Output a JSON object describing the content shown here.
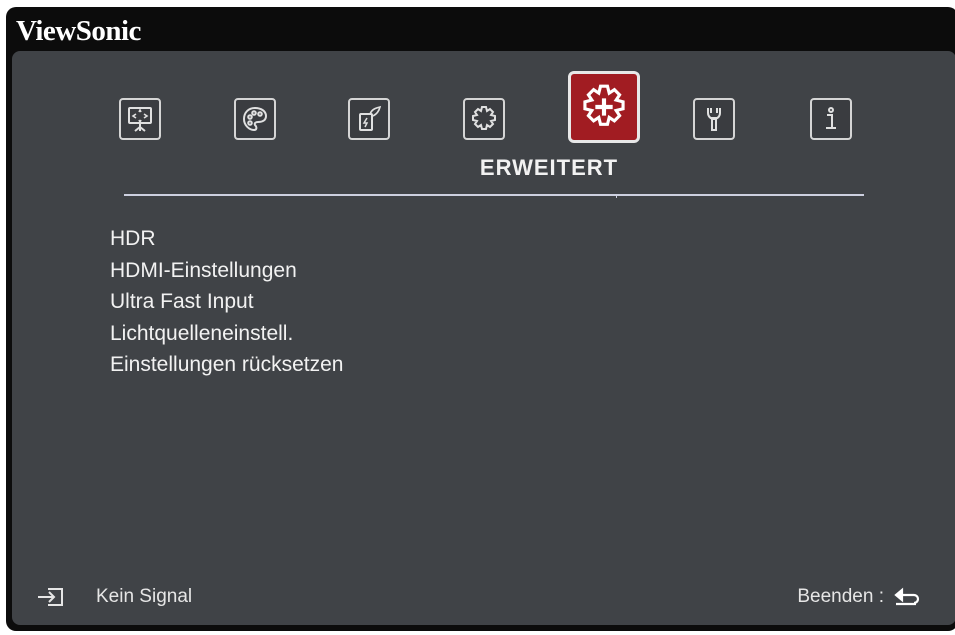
{
  "brand": "ViewSonic",
  "tabs": [
    {
      "icon": "projector-screen-icon",
      "active": false
    },
    {
      "icon": "palette-icon",
      "active": false
    },
    {
      "icon": "power-management-icon",
      "active": false
    },
    {
      "icon": "basic-gear-icon",
      "active": false
    },
    {
      "icon": "advanced-gear-plus-icon",
      "active": true
    },
    {
      "icon": "wrench-icon",
      "active": false
    },
    {
      "icon": "info-icon",
      "active": false
    }
  ],
  "section_title": "ERWEITERT",
  "menu_items": [
    "HDR",
    "HDMI-Einstellungen",
    "Ultra Fast Input",
    "Lichtquelleneinstell.",
    "Einstellungen rücksetzen"
  ],
  "footer": {
    "signal_status": "Kein Signal",
    "exit_label": "Beenden :"
  },
  "colors": {
    "panel_bg": "#404347",
    "active_tab": "#a11c22",
    "text": "#f2f2f2"
  }
}
